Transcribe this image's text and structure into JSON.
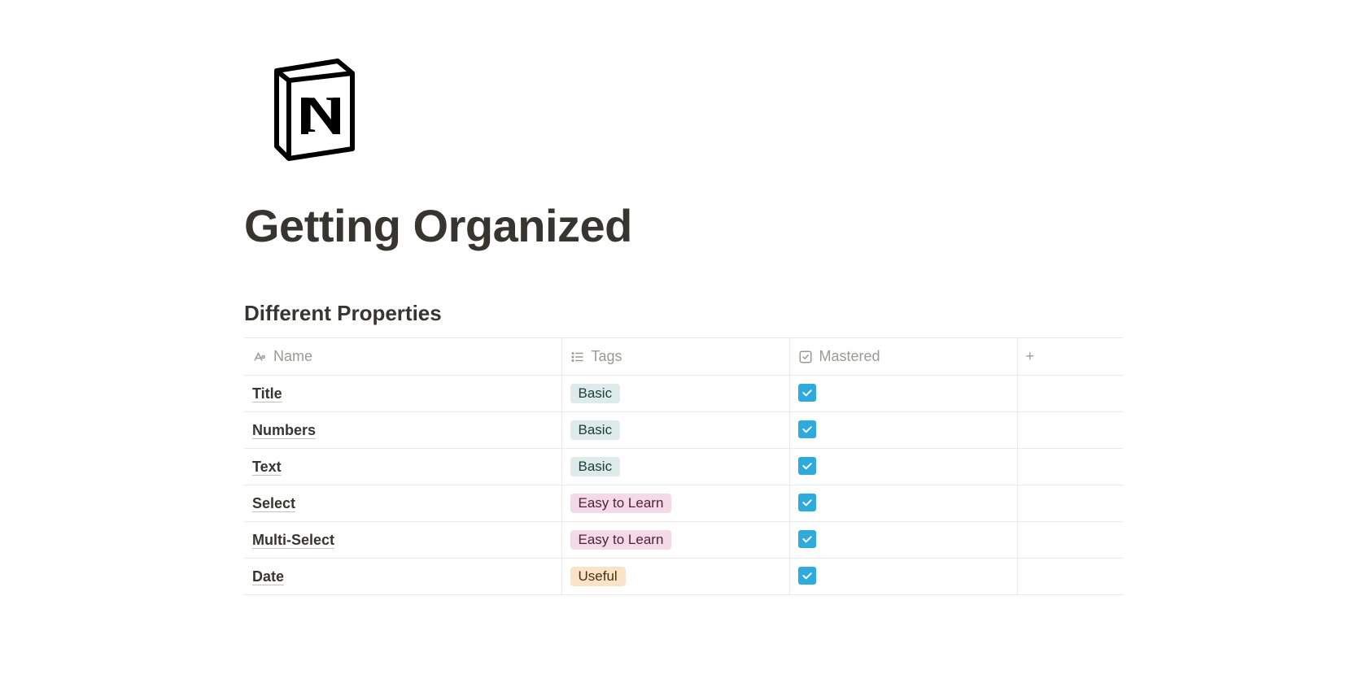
{
  "page": {
    "title": "Getting Organized",
    "icon": "notion-logo"
  },
  "database": {
    "title": "Different Properties",
    "columns": [
      {
        "key": "name",
        "label": "Name",
        "icon": "title-icon"
      },
      {
        "key": "tags",
        "label": "Tags",
        "icon": "multiselect-icon"
      },
      {
        "key": "mastered",
        "label": "Mastered",
        "icon": "checkbox-icon"
      }
    ],
    "add_column": "+",
    "rows": [
      {
        "name": "Title",
        "tag": "Basic",
        "tag_color": "green",
        "mastered": true
      },
      {
        "name": "Numbers",
        "tag": "Basic",
        "tag_color": "green",
        "mastered": true
      },
      {
        "name": "Text",
        "tag": "Basic",
        "tag_color": "green",
        "mastered": true
      },
      {
        "name": "Select",
        "tag": "Easy to Learn",
        "tag_color": "pink",
        "mastered": true
      },
      {
        "name": "Multi-Select",
        "tag": "Easy to Learn",
        "tag_color": "pink",
        "mastered": true
      },
      {
        "name": "Date",
        "tag": "Useful",
        "tag_color": "orange",
        "mastered": true
      }
    ]
  },
  "colors": {
    "accent": "#2eaadc",
    "text": "#37352f",
    "muted": "#9b9a97",
    "border": "#e9e9e7"
  }
}
